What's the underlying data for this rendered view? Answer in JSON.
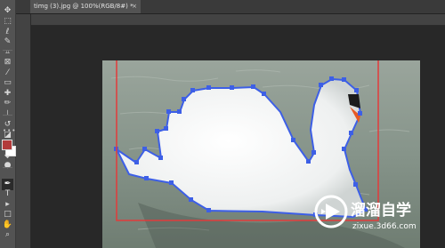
{
  "document_tab": {
    "title": "timg (3).jpg @ 100%(RGB/8#) *",
    "close_glyph": "×"
  },
  "tools": [
    {
      "name": "move-tool-icon",
      "glyph": "✥"
    },
    {
      "name": "marquee-tool-icon",
      "glyph": "⬚"
    },
    {
      "name": "lasso-tool-icon",
      "glyph": "ℓ"
    },
    {
      "name": "quick-select-tool-icon",
      "glyph": "✎"
    },
    {
      "name": "crop-tool-icon",
      "glyph": "⌗"
    },
    {
      "name": "frame-tool-icon",
      "glyph": "⊠"
    },
    {
      "name": "eyedropper-tool-icon",
      "glyph": "⁄"
    },
    {
      "name": "ruler-tool-icon",
      "glyph": "▭"
    },
    {
      "name": "healing-brush-tool-icon",
      "glyph": "✚"
    },
    {
      "name": "brush-tool-icon",
      "glyph": "✏"
    },
    {
      "name": "clone-stamp-tool-icon",
      "glyph": "⊥"
    },
    {
      "name": "history-brush-tool-icon",
      "glyph": "↺"
    },
    {
      "name": "eraser-tool-icon",
      "glyph": "◪"
    },
    {
      "name": "gradient-tool-icon",
      "glyph": "▤"
    },
    {
      "name": "blur-tool-icon",
      "glyph": "◆"
    },
    {
      "name": "dodge-tool-icon",
      "glyph": "●"
    },
    {
      "name": "pen-tool-icon",
      "glyph": "✒"
    },
    {
      "name": "type-tool-icon",
      "glyph": "T"
    },
    {
      "name": "path-selection-tool-icon",
      "glyph": "▸"
    },
    {
      "name": "rectangle-tool-icon",
      "glyph": "□"
    },
    {
      "name": "hand-tool-icon",
      "glyph": "✋"
    },
    {
      "name": "zoom-tool-icon",
      "glyph": "⌕"
    }
  ],
  "active_tool": "pen-tool-icon",
  "more_tools_glyph": "•••",
  "colors": {
    "foreground": "#b23a3a",
    "background": "#ffffff",
    "path_stroke": "#3d5fe6",
    "crop_frame": "#e23b3b"
  },
  "watermark": {
    "brand": "溜溜自学",
    "url": "zixue.3d66.com"
  }
}
